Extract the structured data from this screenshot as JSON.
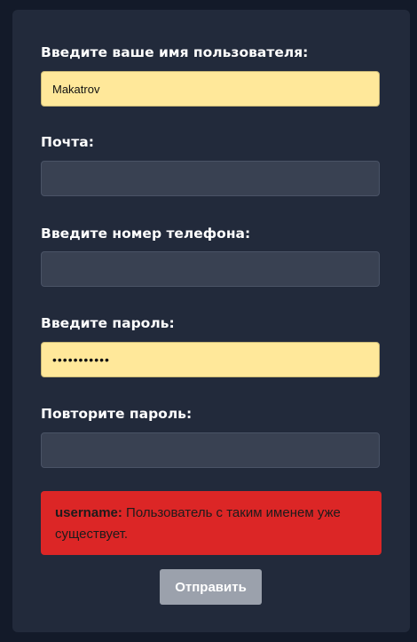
{
  "form": {
    "fields": [
      {
        "label": "Введите ваше имя пользователя:",
        "value": "Makatrov",
        "placeholder": ""
      },
      {
        "label": "Почта:",
        "value": "",
        "placeholder": ""
      },
      {
        "label": "Введите номер телефона:",
        "value": "",
        "placeholder": ""
      },
      {
        "label": "Введите пароль:",
        "value": "•••••••••••",
        "placeholder": ""
      },
      {
        "label": "Повторите пароль:",
        "value": "",
        "placeholder": ""
      }
    ],
    "error": {
      "field": "username:",
      "message": " Пользователь с таким именем уже существует."
    },
    "submit_label": "Отправить"
  },
  "colors": {
    "page_background": "#131a29",
    "card_background": "#222a3b",
    "input_background": "#394152",
    "autofill_background": "#ffe89a",
    "error_background": "#dc2626",
    "button_background": "#9ba1ac"
  }
}
